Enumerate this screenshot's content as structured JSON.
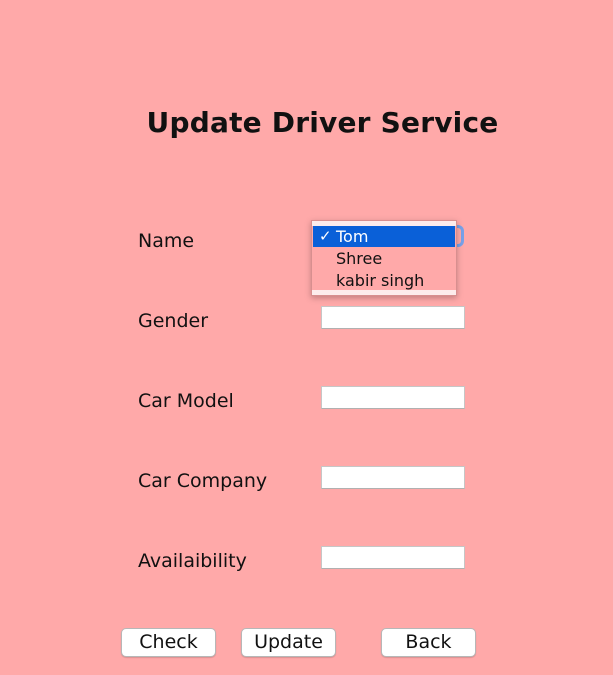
{
  "form": {
    "title": "Update Driver Service",
    "labels": {
      "name": "Name",
      "gender": "Gender",
      "car_model": "Car Model",
      "car_company": "Car Company",
      "availability": "Availaibility"
    },
    "values": {
      "gender": "",
      "car_model": "",
      "car_company": "",
      "availability": ""
    }
  },
  "name_dropdown": {
    "selected": "Tom",
    "check_glyph": "✓",
    "options": [
      "Tom",
      "Shree",
      "kabir singh"
    ]
  },
  "buttons": {
    "check": "Check",
    "update": "Update",
    "back": "Back"
  },
  "colors": {
    "background": "#ffa9a9",
    "selection": "#0a60d8"
  }
}
